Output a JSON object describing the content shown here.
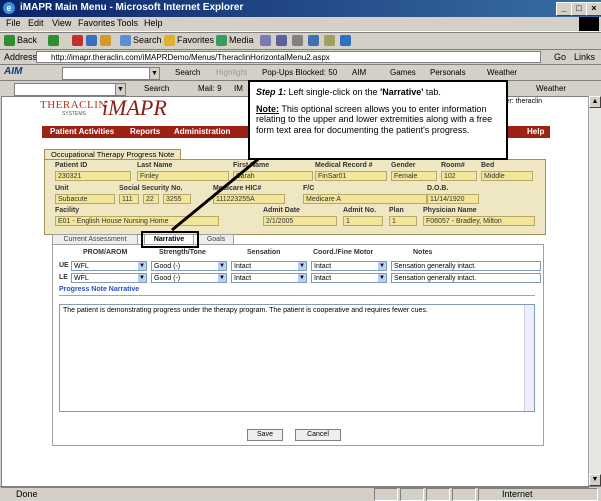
{
  "window": {
    "title": "iMAPR Main Menu - Microsoft Internet Explorer"
  },
  "menu": [
    "File",
    "Edit",
    "View",
    "Favorites",
    "Tools",
    "Help"
  ],
  "toolbar": {
    "back": "Back",
    "search": "Search",
    "favorites": "Favorites",
    "media": "Media"
  },
  "address": {
    "label": "Address",
    "url": "http://imapr.theraclin.com/iMAPRDemo/Menus/TheraclinHorizontalMenu2.aspx",
    "go": "Go",
    "links": "Links"
  },
  "aim": {
    "brand": "AIM",
    "search": "Search",
    "highlight": "Highlight",
    "popups": "Pop-Ups Blocked: 50",
    "aim_menu": "AIM",
    "games": "Games",
    "personals": "Personals",
    "weather": "Weather"
  },
  "aim2": {
    "search": "Search",
    "mail": "Mail: 9",
    "im": "IM",
    "weather": "Weather",
    "user": "ser: theraclin"
  },
  "app": {
    "logo": "THERACLIN",
    "logo_sub": "SYSTEMS",
    "product": "iMAPR",
    "nav": [
      "Patient Activities",
      "Reports",
      "Administration",
      "Help"
    ],
    "form_title": "Occupational Therapy Progress Note"
  },
  "patient": {
    "patient_id_label": "Patient ID",
    "patient_id": "230321",
    "last_name_label": "Last Name",
    "last_name": "Finley",
    "first_name_label": "First Name",
    "first_name": "Sarah",
    "med_record_label": "Medical Record #",
    "med_record": "FinSar01",
    "gender_label": "Gender",
    "gender": "Female",
    "room_label": "Room#",
    "room": "102",
    "bed_label": "Bed",
    "bed": "Middle",
    "unit_label": "Unit",
    "unit": "Subacute",
    "ssn_label": "Social Security No.",
    "ssn1": "111",
    "ssn2": "22",
    "ssn3": "3255",
    "medicare_label": "Medicare HIC#",
    "medicare": "111223255A",
    "fc_label": "F/C",
    "fc": "Medicare A",
    "dob_label": "D.O.B.",
    "dob": "11/14/1920",
    "facility_label": "Facility",
    "facility": "E01 - English House Nursing Home",
    "admit_date_label": "Admit Date",
    "admit_date": "2/1/2005",
    "admit_no_label": "Admit No.",
    "admit_no": "1",
    "plan_label": "Plan",
    "plan": "1",
    "physician_label": "Physician Name",
    "physician": "F06057 - Bradley, Milton"
  },
  "tabs": [
    "Current Assessment",
    "Narrative",
    "Goals"
  ],
  "columns": [
    "PROM/AROM",
    "Strength/Tone",
    "Sensation",
    "Coord./Fine Motor",
    "Notes"
  ],
  "rows": [
    {
      "label": "UE",
      "prom": "WFL",
      "strength": "Good (-)",
      "sensation": "Intact",
      "coord": "Intact",
      "notes": "Sensation generally intact."
    },
    {
      "label": "LE",
      "prom": "WFL",
      "strength": "Good (-)",
      "sensation": "Intact",
      "coord": "Intact",
      "notes": "Sensation generally intact."
    }
  ],
  "narrative": {
    "label": "Progress Note Narrative",
    "text": "The patient is demonstrating progress under the therapy program. The patient is cooperative and requires fewer cues."
  },
  "buttons": {
    "save": "Save",
    "cancel": "Cancel"
  },
  "callout": {
    "step": "Step 1:",
    "step_text": " Left single-click on the ",
    "target": "'Narrative'",
    "step_end": " tab.",
    "note_label": "Note:",
    "note_text": " This optional screen allows you to enter information relating to the upper and lower extremities along with a free form text area for documenting the patient's progress."
  },
  "status": {
    "text": "Done",
    "zone": "Internet"
  },
  "colors": {
    "brand": "#9b2214",
    "titlebar": "#0a246a",
    "field": "#f2e69a"
  }
}
